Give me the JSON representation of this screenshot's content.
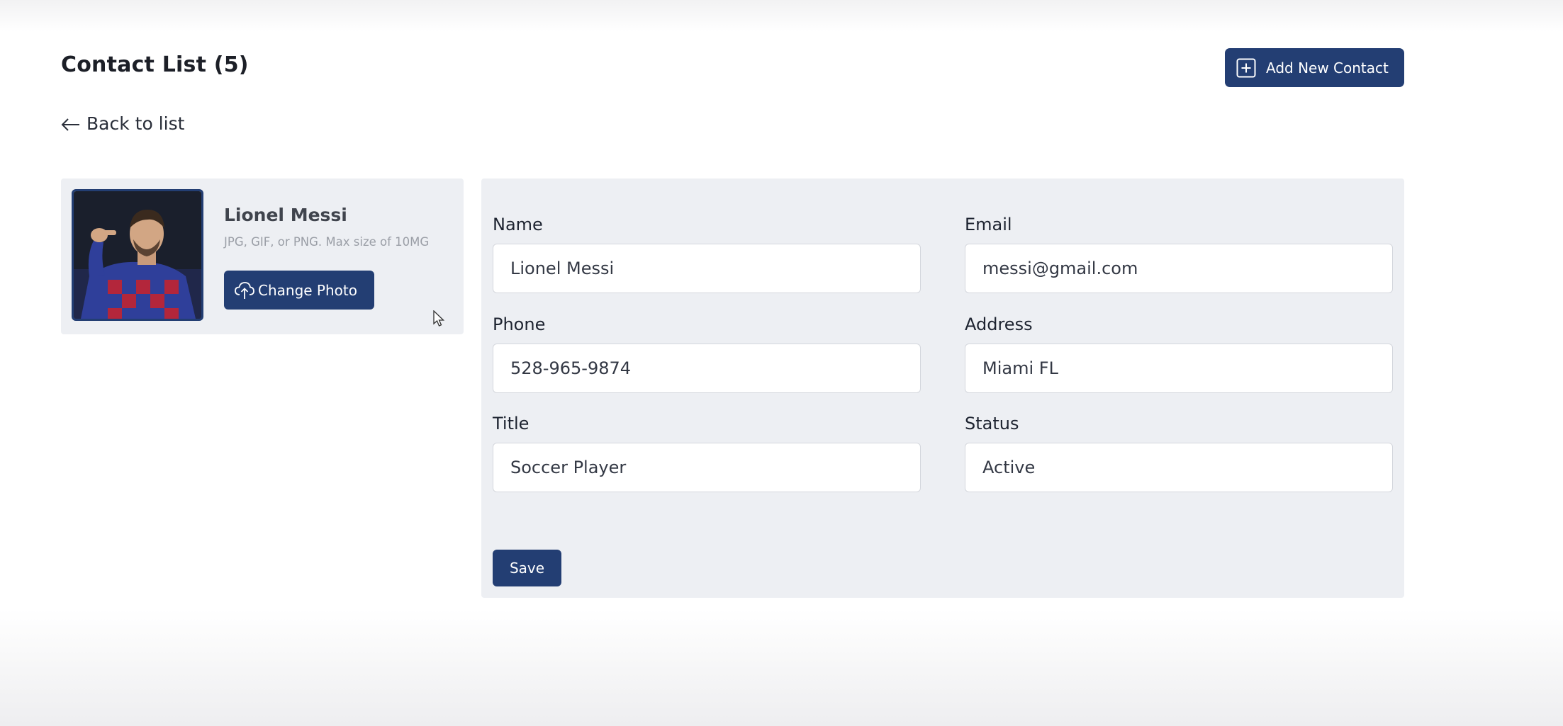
{
  "header": {
    "title": "Contact List (5)",
    "add_button_label": "Add New Contact",
    "add_icon": "plus-square-icon"
  },
  "navigation": {
    "back_label": "Back to list",
    "back_icon": "arrow-left-icon"
  },
  "profile": {
    "name": "Lionel Messi",
    "hint": "JPG, GIF, or PNG. Max size of 10MG",
    "change_photo_label": "Change Photo",
    "change_photo_icon": "cloud-upload-icon",
    "photo_alt": "Lionel Messi"
  },
  "form": {
    "fields": [
      {
        "label": "Name",
        "value": "Lionel Messi"
      },
      {
        "label": "Email",
        "value": "messi@gmail.com"
      },
      {
        "label": "Phone",
        "value": "528-965-9874"
      },
      {
        "label": "Address",
        "value": "Miami FL"
      },
      {
        "label": "Title",
        "value": "Soccer Player"
      },
      {
        "label": "Status",
        "value": "Active"
      }
    ],
    "save_label": "Save"
  },
  "colors": {
    "accent": "#233e73",
    "card_background": "#edeff3",
    "page_background": "#ffffff"
  }
}
